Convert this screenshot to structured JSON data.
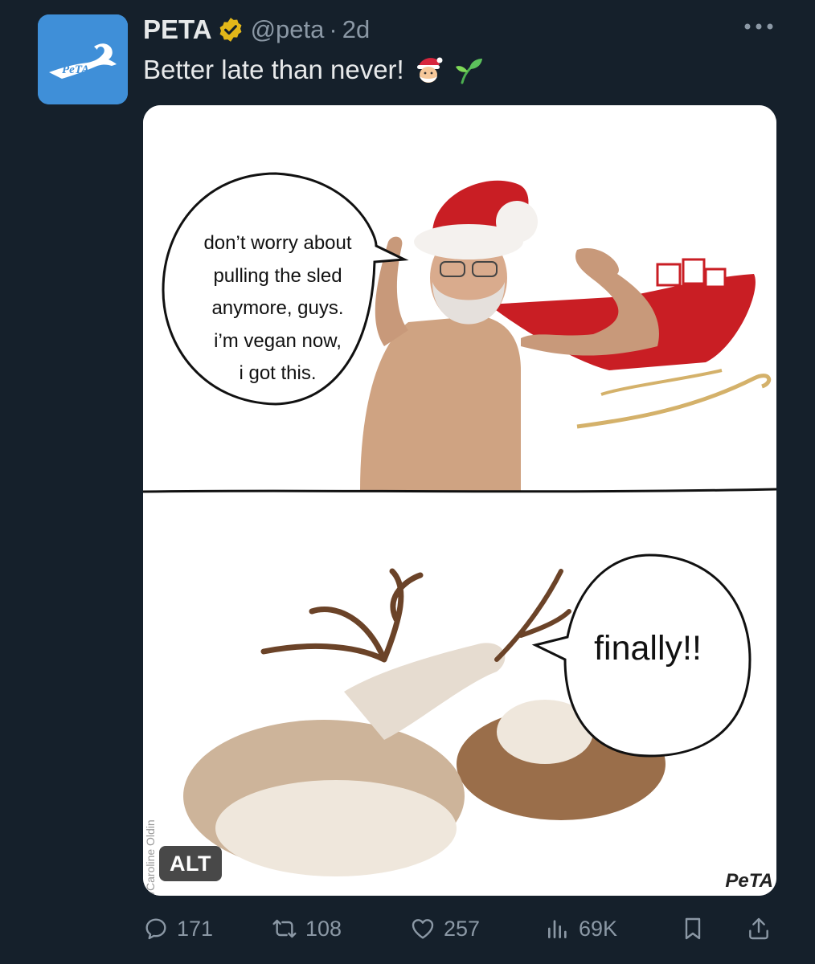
{
  "author": {
    "name": "PETA",
    "handle": "@peta",
    "separator": "·",
    "time": "2d",
    "avatar_logo_text": "PeTA"
  },
  "tweet": {
    "text": "Better late than never!",
    "emojis": [
      "santa-emoji",
      "seedling-emoji"
    ]
  },
  "media": {
    "panel1_bubble_lines": [
      "don’t worry about",
      "pulling the sled",
      "anymore, guys.",
      "i’m vegan now,",
      "i got this."
    ],
    "panel2_bubble": "finally!!",
    "credit": "iStock/Caroline Oldin",
    "alt_label": "ALT",
    "watermark": "PeTA"
  },
  "actions": {
    "replies": "171",
    "reposts": "108",
    "likes": "257",
    "views": "69K"
  },
  "colors": {
    "background": "#15202b",
    "text": "#e7e9ea",
    "muted": "#8b98a5",
    "avatar": "#3f8fd8",
    "verified_gold": "#e2b719"
  }
}
